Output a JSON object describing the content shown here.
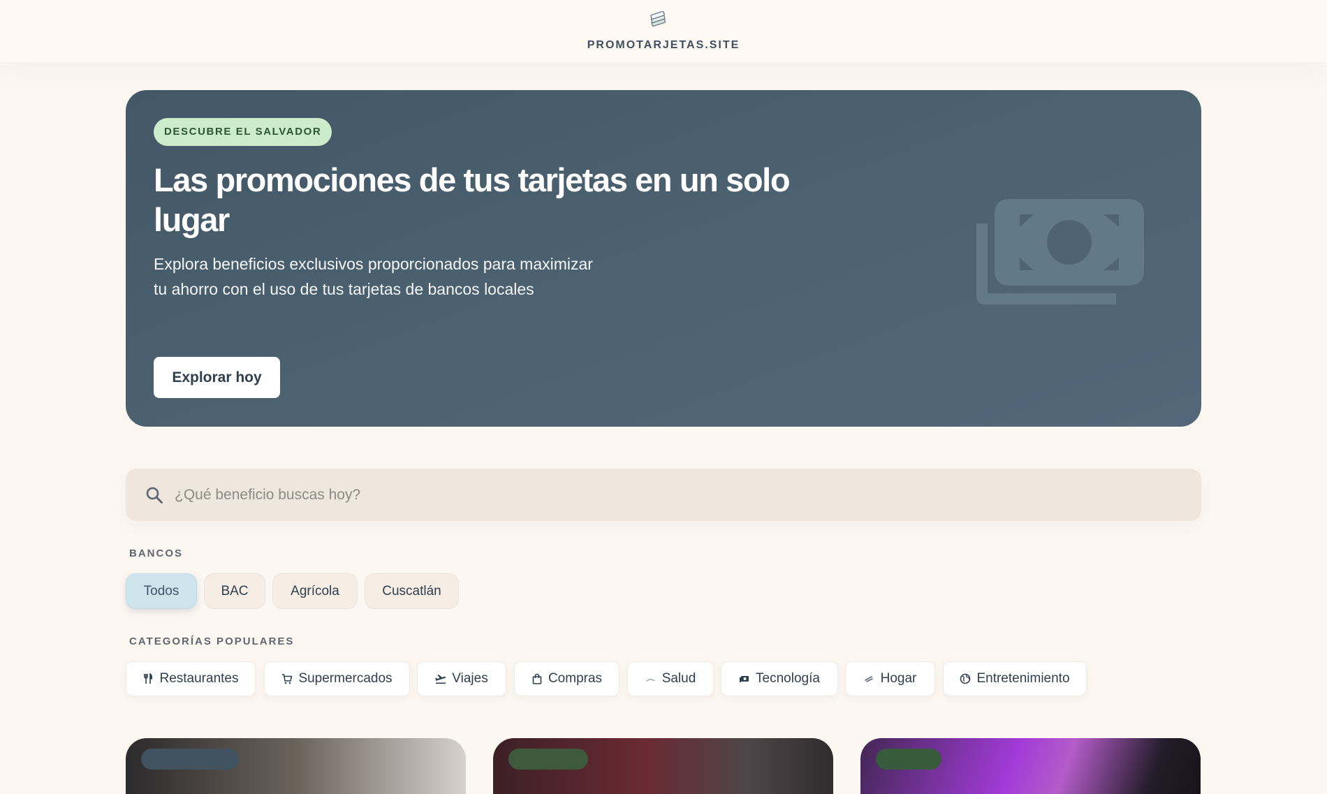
{
  "header": {
    "logo_icon": "money-stack-icon",
    "site_name": "PROMOTARJETAS.SITE"
  },
  "hero": {
    "badge": "DESCUBRE EL SALVADOR",
    "title": "Las promociones de tus tarjetas en un solo lugar",
    "description": "Explora beneficios exclusivos proporcionados para maximizar tu ahorro con el uso de tus tarjetas de bancos locales",
    "cta_label": "Explorar hoy",
    "decor_icon": "banknotes-icon"
  },
  "search": {
    "placeholder": "¿Qué beneficio buscas hoy?",
    "value": "",
    "icon": "search-icon"
  },
  "banks": {
    "label": "BANCOS",
    "items": [
      {
        "label": "Todos",
        "selected": true
      },
      {
        "label": "BAC",
        "selected": false
      },
      {
        "label": "Agrícola",
        "selected": false
      },
      {
        "label": "Cuscatlán",
        "selected": false
      }
    ]
  },
  "categories": {
    "label": "CATEGORÍAS POPULARES",
    "items": [
      {
        "label": "Restaurantes",
        "icon": "utensils-icon"
      },
      {
        "label": "Supermercados",
        "icon": "cart-icon"
      },
      {
        "label": "Viajes",
        "icon": "plane-icon"
      },
      {
        "label": "Compras",
        "icon": "shopping-bag-icon"
      },
      {
        "label": "Salud",
        "icon": "health-icon"
      },
      {
        "label": "Tecnología",
        "icon": "tech-icon"
      },
      {
        "label": "Hogar",
        "icon": "home-icon"
      },
      {
        "label": "Entretenimiento",
        "icon": "globe-icon"
      }
    ]
  },
  "colors": {
    "page_bg": "#fdf7f2",
    "hero_bg": "#4b5f6d",
    "badge_bg": "#cdeccc",
    "active_chip": "#cde4ed",
    "search_bg": "#efe6dd"
  }
}
